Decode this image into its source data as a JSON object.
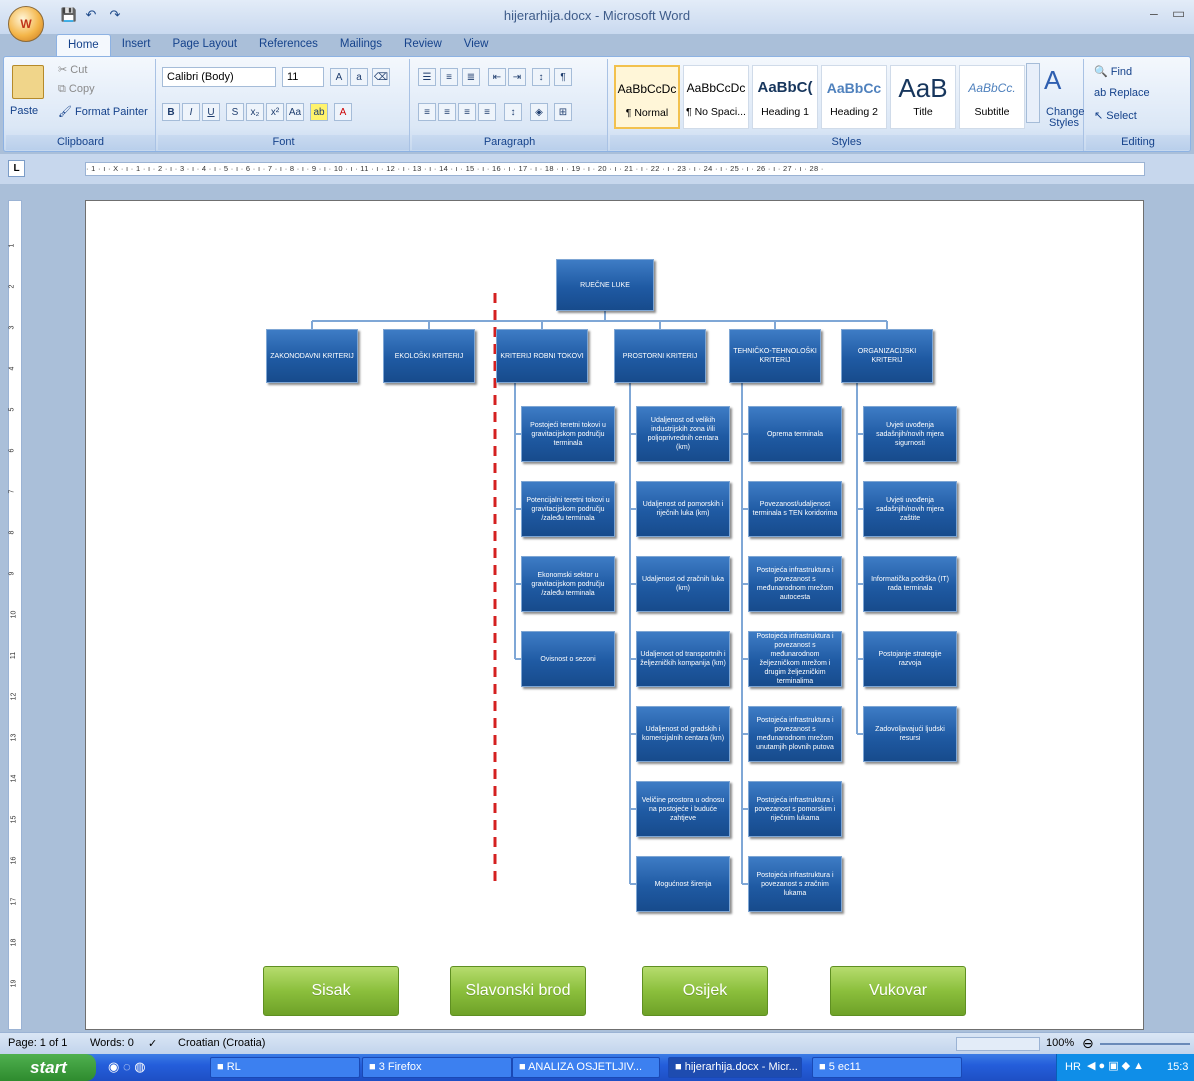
{
  "window": {
    "title": "hijerarhija.docx - Microsoft Word",
    "minimize": "–",
    "restore": "▭"
  },
  "office_button": "W",
  "qat": {
    "save": "💾",
    "undo": "↶",
    "redo": "↷"
  },
  "tabs": [
    "Home",
    "Insert",
    "Page Layout",
    "References",
    "Mailings",
    "Review",
    "View"
  ],
  "ribbon": {
    "clipboard": {
      "label": "Clipboard",
      "paste": "Paste",
      "cut": "Cut",
      "copy": "Copy",
      "format_painter": "Format Painter"
    },
    "font": {
      "label": "Font",
      "family": "Calibri (Body)",
      "size": "11"
    },
    "paragraph": {
      "label": "Paragraph"
    },
    "styles": {
      "label": "Styles",
      "items": [
        {
          "sample": "AaBbCcDc",
          "name": "¶ Normal"
        },
        {
          "sample": "AaBbCcDc",
          "name": "¶ No Spaci..."
        },
        {
          "sample": "AaBbC(",
          "name": "Heading 1"
        },
        {
          "sample": "AaBbCc",
          "name": "Heading 2"
        },
        {
          "sample": "AaB",
          "name": "Title"
        },
        {
          "sample": "AaBbCc.",
          "name": "Subtitle"
        }
      ],
      "change_styles": "Change Styles"
    },
    "editing": {
      "label": "Editing",
      "find": "Find",
      "replace": "Replace",
      "select": "Select"
    }
  },
  "ruler_text": "· 1 · ı · X · ı · 1 · ı · 2 · ı · 3 · ı · 4 · ı · 5 · ı · 6 · ı · 7 · ı · 8 · ı · 9 · ı · 10 · ı · 11 · ı · 12 · ı · 13 · ı · 14 · ı · 15 · ı · 16 · ı · 17 · ı · 18 · ı · 19 · ı · 20 · ı · 21 · ı · 22 · ı · 23 · ı · 24 · ı · 25 · ı · 26 · ı · 27 · ı · 28 ·",
  "diagram": {
    "root": "RUEČNE LUKE",
    "criteria": [
      {
        "title": "ZAKONODAVNI KRITERIJ",
        "children": []
      },
      {
        "title": "EKOLOŠKI KRITERIJ",
        "children": []
      },
      {
        "title": "KRITERIJ ROBNI TOKOVI",
        "children": [
          "Postojeći teretni tokovi u gravitacijskom području terminala",
          "Potencijalni teretni tokovi u gravitacijskom području /zaleđu terminala",
          "Ekonomski sektor u gravitacijskom području /zaleđu terminala",
          "Ovisnost o sezoni"
        ]
      },
      {
        "title": "PROSTORNI KRITERIJ",
        "children": [
          "Udaljenost od velikih industrijskih zona i/ili poljoprivrednih centara (km)",
          "Udaljenost od pomorskih i riječnih luka (km)",
          "Udaljenost od zračnih luka (km)",
          "Udaljenost od transportnih i željezničkih kompanija (km)",
          "Udaljenost od gradskih i komercijalnih centara (km)",
          "Veličine prostora u odnosu na postojeće i buduće zahtjeve",
          "Mogućnost širenja"
        ]
      },
      {
        "title": "TEHNIČKO-TEHNOLOŠKI KRITERIJ",
        "children": [
          "Oprema terminala",
          "Povezanost/udaljenost terminala s TEN koridorima",
          "Postojeća infrastruktura i povezanost s međunarodnom mrežom autocesta",
          "Postojeća infrastruktura i povezanost s međunarodnom željezničkom mrežom i drugim željezničkim terminalima",
          "Postojeća infrastruktura i povezanost s međunarodnom mrežom unutarnjih plovnih putova",
          "Postojeća infrastruktura i povezanost s pomorskim i riječnim lukama",
          "Postojeća infrastruktura i povezanost s zračnim lukama"
        ]
      },
      {
        "title": "ORGANIZACIJSKI KRITERIJ",
        "children": [
          "Uvjeti uvođenja sadašnjih/novih mjera sigurnosti",
          "Uvjeti uvođenja sadašnjih/novih mjera zaštite",
          "Informatička podrška (IT) rada terminala",
          "Postojanje strategije razvoja",
          "Zadovoljavajući ljudski resursi"
        ]
      }
    ],
    "cities": [
      "Sisak",
      "Slavonski brod",
      "Osijek",
      "Vukovar"
    ]
  },
  "status": {
    "page": "Page: 1 of 1",
    "words": "Words: 0",
    "language": "Croatian (Croatia)",
    "zoom": "100%"
  },
  "taskbar": {
    "start": "start",
    "tasks": [
      "RL",
      "3 Firefox",
      "ANALIZA OSJETLJIV...",
      "hijerarhija.docx - Micr...",
      "5 ec11"
    ],
    "tray_lang": "HR",
    "clock": "15:3"
  }
}
